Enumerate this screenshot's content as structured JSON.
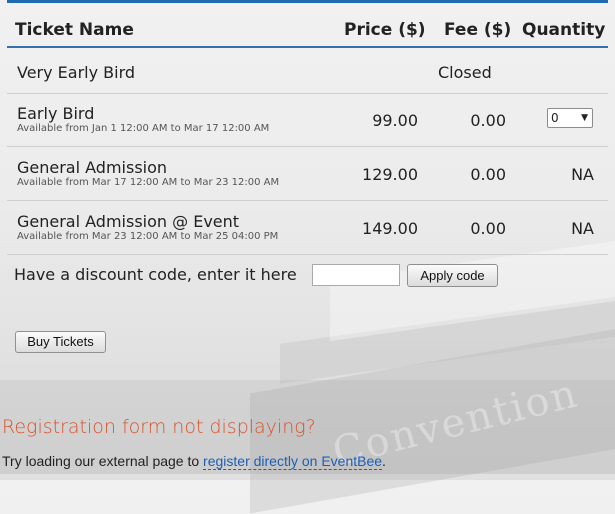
{
  "table": {
    "headers": {
      "name": "Ticket Name",
      "price": "Price ($)",
      "fee": "Fee ($)",
      "quantity": "Quantity"
    },
    "tickets": [
      {
        "name": "Very Early Bird",
        "availability": "",
        "price": "",
        "fee": "",
        "quantity": "",
        "status": "Closed"
      },
      {
        "name": "Early Bird",
        "availability": "Available from Jan 1 12:00 AM to Mar 17 12:00 AM",
        "price": "99.00",
        "fee": "0.00",
        "quantity": "0",
        "status": ""
      },
      {
        "name": "General Admission",
        "availability": "Available from Mar 17 12:00 AM to Mar 23 12:00 AM",
        "price": "129.00",
        "fee": "0.00",
        "quantity": "NA",
        "status": ""
      },
      {
        "name": "General Admission @ Event",
        "availability": "Available from Mar 23 12:00 AM to Mar 25 04:00 PM",
        "price": "149.00",
        "fee": "0.00",
        "quantity": "NA",
        "status": ""
      }
    ]
  },
  "discount": {
    "label": "Have a discount code, enter it here",
    "value": "",
    "apply_label": "Apply code"
  },
  "buy_label": "Buy Tickets",
  "registration": {
    "title": "Registration form not displaying?",
    "hint_prefix": "Try loading our external page to ",
    "link_text": "register directly on EventBee",
    "hint_suffix": "."
  },
  "background_text": "Convention",
  "colors": {
    "accent": "#1f69b1",
    "heading_orange": "#d9532a",
    "link": "#1c5fb6"
  },
  "icons": {
    "select_arrow": "chevron-down-icon"
  }
}
